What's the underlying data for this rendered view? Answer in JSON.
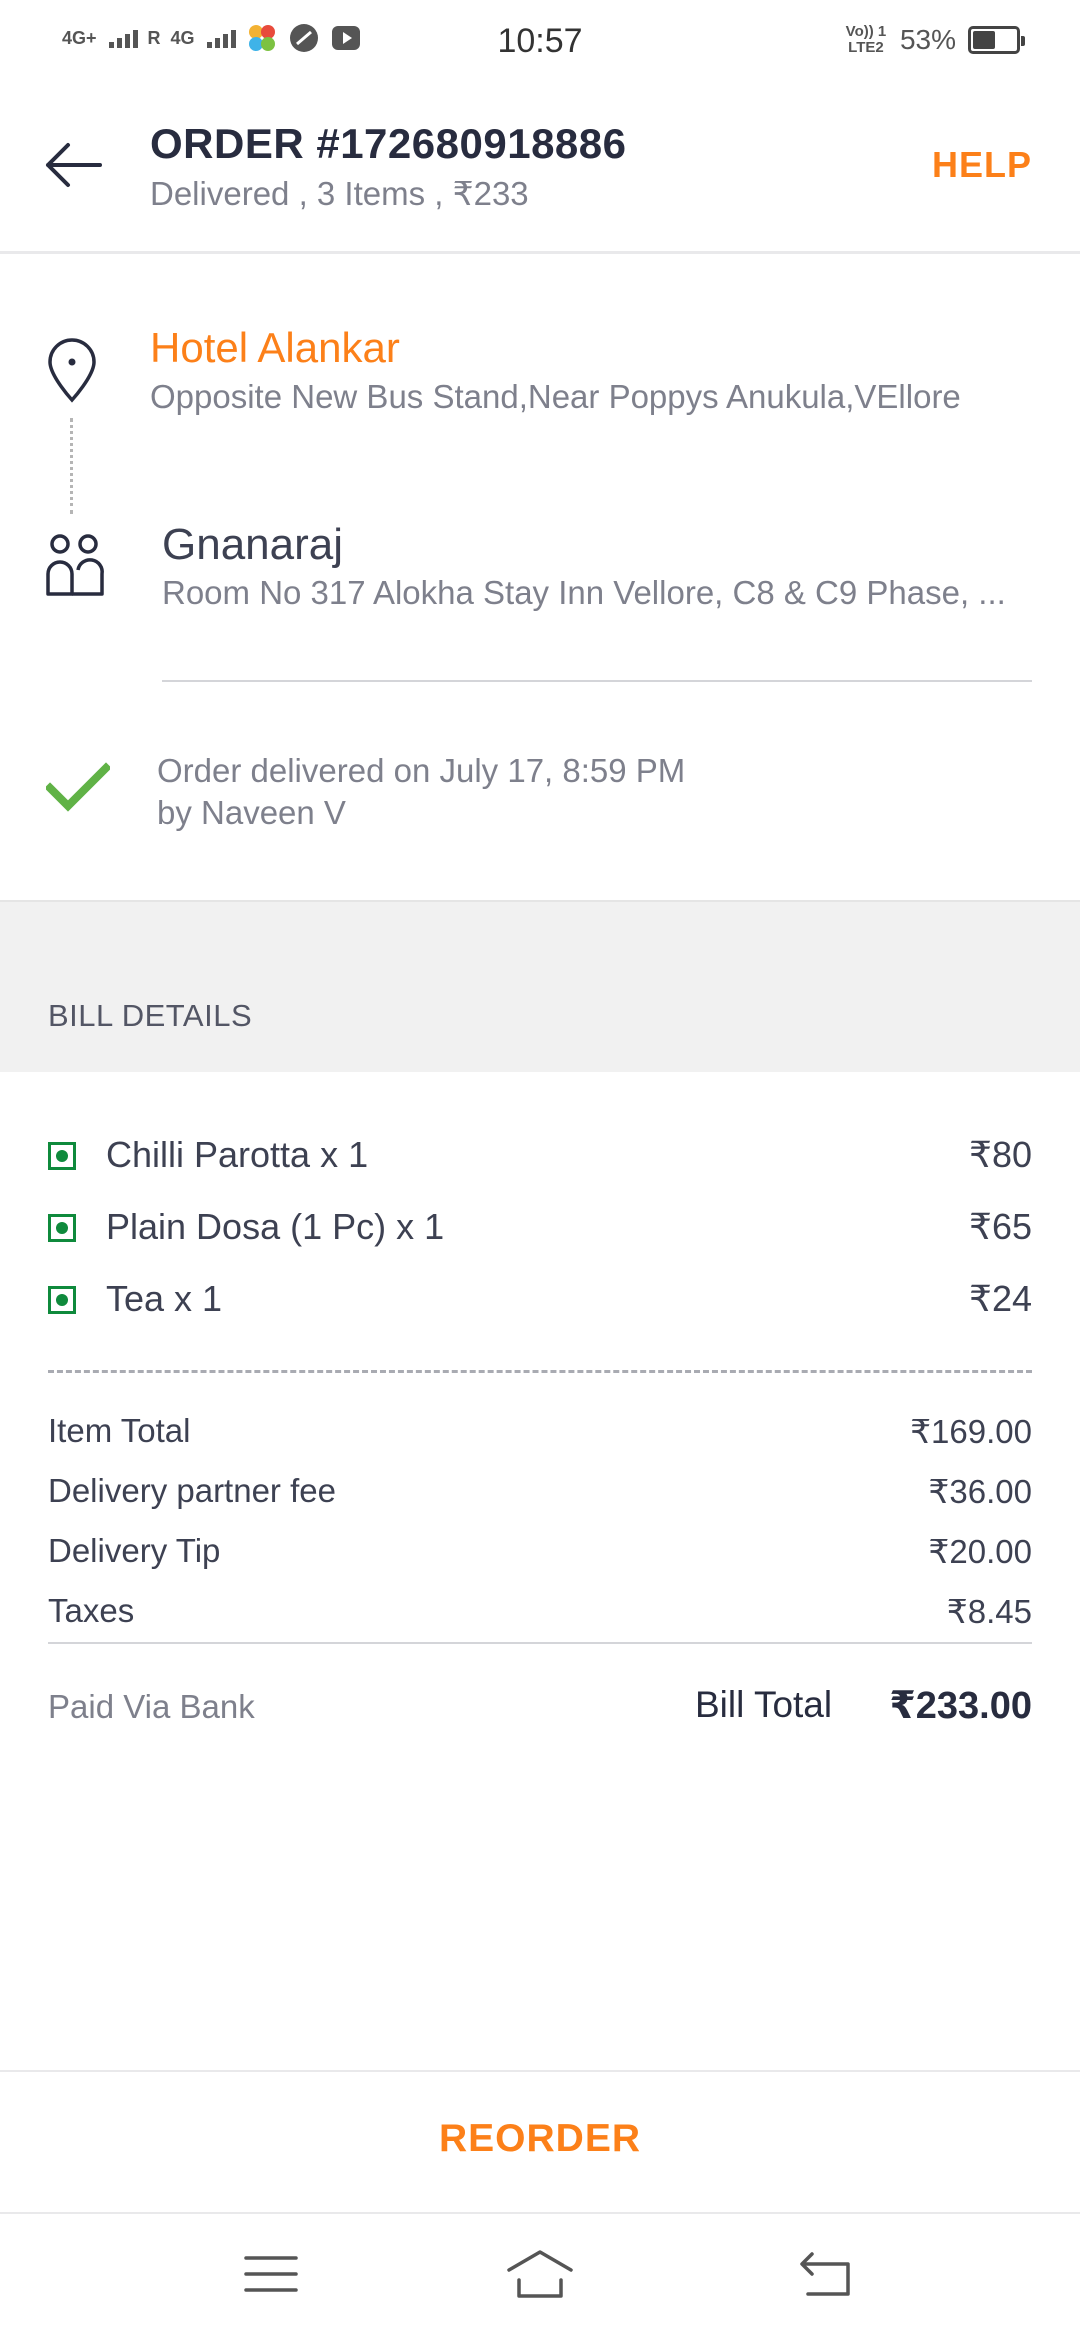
{
  "status_bar": {
    "network_1": "4G+",
    "network_2": "4G",
    "roaming": "R",
    "time": "10:57",
    "volte": "Vo)) 1 LTE2",
    "battery_percent": "53%",
    "battery_level": 0.53
  },
  "header": {
    "title": "ORDER #172680918886",
    "subtitle": "Delivered , 3 Items , ₹233",
    "help_label": "HELP",
    "accent_color": "#fc8019"
  },
  "restaurant": {
    "name": "Hotel Alankar",
    "address": "Opposite New Bus Stand,Near Poppys Anukula,VEllore"
  },
  "customer": {
    "name": "Gnanaraj",
    "address": "Room No 317 Alokha Stay Inn Vellore, C8 & C9 Phase, ..."
  },
  "delivery": {
    "line1": "Order delivered on July 17, 8:59 PM",
    "line2": "by Naveen V",
    "status_color": "#60b246"
  },
  "bill": {
    "title": "BILL DETAILS",
    "items": [
      {
        "name": "Chilli Parotta x 1",
        "price": "₹80"
      },
      {
        "name": "Plain Dosa (1 Pc) x 1",
        "price": "₹65"
      },
      {
        "name": "Tea x 1",
        "price": "₹24"
      }
    ],
    "charges": [
      {
        "label": "Item Total",
        "value": "₹169.00"
      },
      {
        "label": "Delivery partner fee",
        "value": "₹36.00"
      },
      {
        "label": "Delivery Tip",
        "value": "₹20.00"
      },
      {
        "label": "Taxes",
        "value": "₹8.45"
      }
    ],
    "paid_via": "Paid Via Bank",
    "total_label": "Bill Total",
    "total_value": "₹233.00"
  },
  "footer": {
    "reorder_label": "REORDER"
  },
  "navbar": {
    "icons": [
      "menu-icon",
      "home-icon",
      "back-icon"
    ]
  }
}
